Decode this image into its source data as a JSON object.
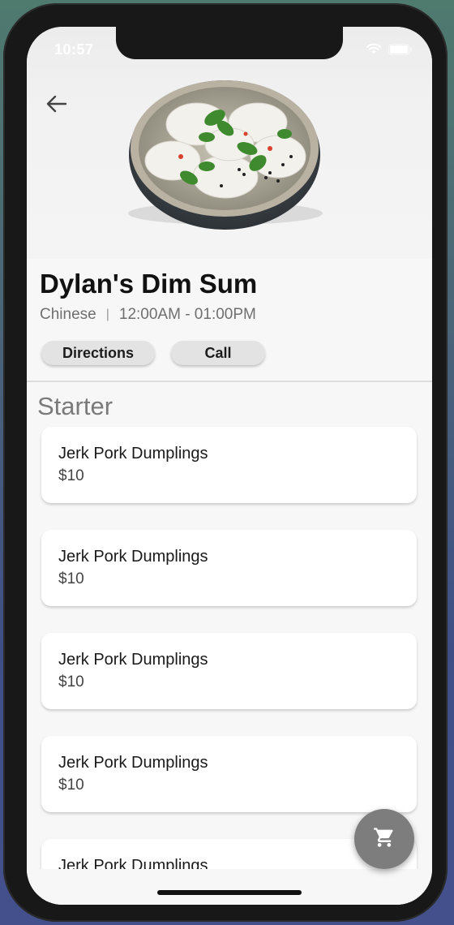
{
  "status_bar": {
    "time": "10:57",
    "icons": [
      "wifi-icon",
      "battery-icon"
    ]
  },
  "header": {
    "back_icon": "arrow-left-icon",
    "hero_image": "bowl of dumplings with cilantro"
  },
  "restaurant": {
    "name": "Dylan's Dim Sum",
    "cuisine": "Chinese",
    "separator": "|",
    "hours": "12:00AM - 01:00PM"
  },
  "actions": {
    "directions_label": "Directions",
    "call_label": "Call"
  },
  "menu": {
    "section_title": "Starter",
    "items": [
      {
        "name": "Jerk Pork Dumplings",
        "price": "$10"
      },
      {
        "name": "Jerk Pork Dumplings",
        "price": "$10"
      },
      {
        "name": "Jerk Pork Dumplings",
        "price": "$10"
      },
      {
        "name": "Jerk Pork Dumplings",
        "price": "$10"
      },
      {
        "name": "Jerk Pork Dumplings",
        "price": ""
      }
    ]
  },
  "fab": {
    "icon": "shopping-cart-icon"
  },
  "colors": {
    "fab_background": "#7d7d7d",
    "pill_background": "#e3e3e3",
    "section_title": "#7a7a7a"
  }
}
